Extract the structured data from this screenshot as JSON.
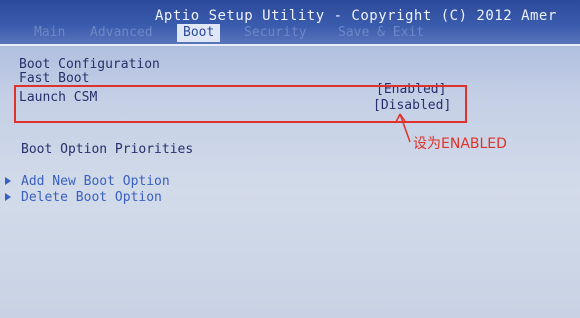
{
  "header": {
    "title": "Aptio Setup Utility - Copyright (C) 2012 Amer",
    "tabs": [
      "Main",
      "Advanced",
      "Boot",
      "Security",
      "Save & Exit"
    ],
    "active_tab": "Boot"
  },
  "boot": {
    "section_title": "Boot Configuration",
    "fast_boot_label": "Fast Boot",
    "fast_boot_value": "[Enabled]",
    "launch_csm_label": "Launch CSM",
    "launch_csm_value": "[Disabled]",
    "priorities_title": "Boot Option Priorities",
    "menu_items": [
      "Add New Boot Option",
      "Delete Boot Option"
    ]
  },
  "annotation": {
    "text": "设为ENABLED"
  },
  "colors": {
    "header_blue": "#2c4a9a",
    "annotation_red": "#e0322b",
    "text_dark": "#27306a",
    "menu_blue": "#3a5fc2"
  }
}
